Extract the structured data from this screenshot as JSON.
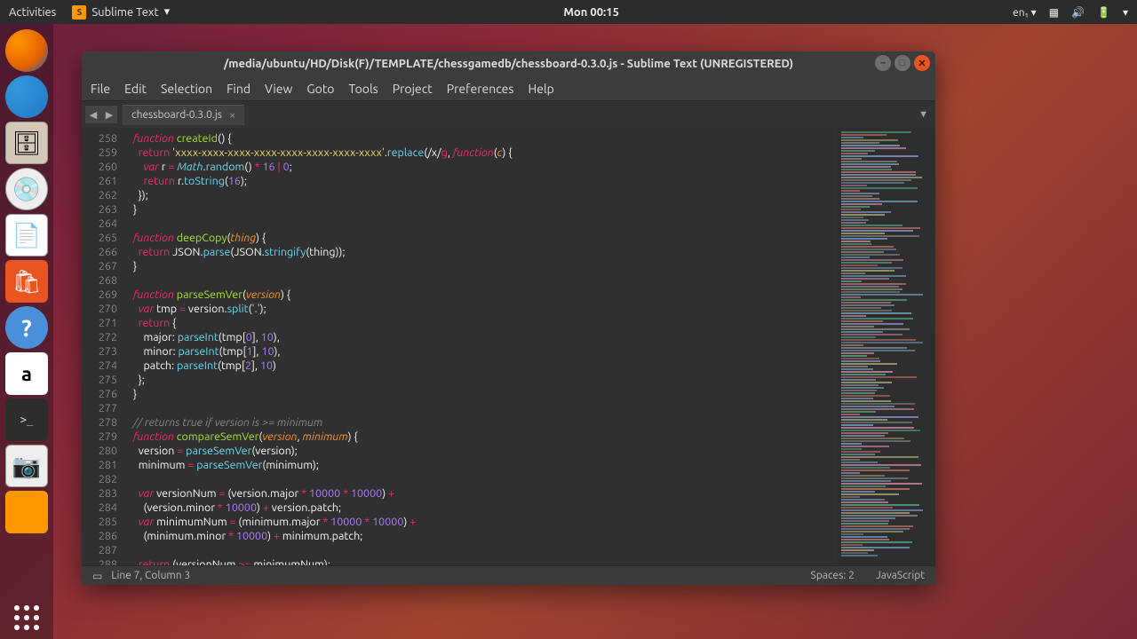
{
  "topbar": {
    "activities": "Activities",
    "app": "Sublime Text",
    "clock": "Mon 00:15",
    "lang": "en₁"
  },
  "window": {
    "title": "/media/ubuntu/HD/Disk(F)/TEMPLATE/chessgamedb/chessboard-0.3.0.js - Sublime Text (UNREGISTERED)",
    "menu": [
      "File",
      "Edit",
      "Selection",
      "Find",
      "View",
      "Goto",
      "Tools",
      "Project",
      "Preferences",
      "Help"
    ],
    "tab": "chessboard-0.3.0.js",
    "status": {
      "pos": "Line 7, Column 3",
      "spaces": "Spaces: 2",
      "lang": "JavaScript"
    }
  },
  "line_start": 258,
  "code": [
    [
      [
        "storage",
        "function"
      ],
      [
        "plain",
        " "
      ],
      [
        "func",
        "createId"
      ],
      [
        "plain",
        "() {"
      ]
    ],
    [
      [
        "plain",
        "  "
      ],
      [
        "keyword",
        "return"
      ],
      [
        "plain",
        " "
      ],
      [
        "str",
        "'xxxx-xxxx-xxxx-xxxx-xxxx-xxxx-xxxx-xxxx'"
      ],
      [
        "plain",
        "."
      ],
      [
        "call",
        "replace"
      ],
      [
        "plain",
        "(/x/"
      ],
      [
        "keyword",
        "g"
      ],
      [
        "plain",
        ", "
      ],
      [
        "storage",
        "function"
      ],
      [
        "plain",
        "("
      ],
      [
        "param",
        "c"
      ],
      [
        "plain",
        ") {"
      ]
    ],
    [
      [
        "plain",
        "    "
      ],
      [
        "storage",
        "var"
      ],
      [
        "plain",
        " r "
      ],
      [
        "op",
        "="
      ],
      [
        "plain",
        " "
      ],
      [
        "builtin",
        "Math"
      ],
      [
        "plain",
        "."
      ],
      [
        "call",
        "random"
      ],
      [
        "plain",
        "() "
      ],
      [
        "op",
        "*"
      ],
      [
        "plain",
        " "
      ],
      [
        "num",
        "16"
      ],
      [
        "plain",
        " "
      ],
      [
        "op",
        "|"
      ],
      [
        "plain",
        " "
      ],
      [
        "num",
        "0"
      ],
      [
        "plain",
        ";"
      ]
    ],
    [
      [
        "plain",
        "    "
      ],
      [
        "keyword",
        "return"
      ],
      [
        "plain",
        " r."
      ],
      [
        "call",
        "toString"
      ],
      [
        "plain",
        "("
      ],
      [
        "num",
        "16"
      ],
      [
        "plain",
        ");"
      ]
    ],
    [
      [
        "plain",
        "  });"
      ]
    ],
    [
      [
        "plain",
        "}"
      ]
    ],
    [
      [
        "plain",
        ""
      ]
    ],
    [
      [
        "storage",
        "function"
      ],
      [
        "plain",
        " "
      ],
      [
        "func",
        "deepCopy"
      ],
      [
        "plain",
        "("
      ],
      [
        "param",
        "thing"
      ],
      [
        "plain",
        ") {"
      ]
    ],
    [
      [
        "plain",
        "  "
      ],
      [
        "keyword",
        "return"
      ],
      [
        "plain",
        " JSON."
      ],
      [
        "call",
        "parse"
      ],
      [
        "plain",
        "(JSON."
      ],
      [
        "call",
        "stringify"
      ],
      [
        "plain",
        "(thing));"
      ]
    ],
    [
      [
        "plain",
        "}"
      ]
    ],
    [
      [
        "plain",
        ""
      ]
    ],
    [
      [
        "storage",
        "function"
      ],
      [
        "plain",
        " "
      ],
      [
        "func",
        "parseSemVer"
      ],
      [
        "plain",
        "("
      ],
      [
        "param",
        "version"
      ],
      [
        "plain",
        ") {"
      ]
    ],
    [
      [
        "plain",
        "  "
      ],
      [
        "storage",
        "var"
      ],
      [
        "plain",
        " tmp "
      ],
      [
        "op",
        "="
      ],
      [
        "plain",
        " version."
      ],
      [
        "call",
        "split"
      ],
      [
        "plain",
        "("
      ],
      [
        "str",
        "'.'"
      ],
      [
        "plain",
        ");"
      ]
    ],
    [
      [
        "plain",
        "  "
      ],
      [
        "keyword",
        "return"
      ],
      [
        "plain",
        " {"
      ]
    ],
    [
      [
        "plain",
        "    major: "
      ],
      [
        "call",
        "parseInt"
      ],
      [
        "plain",
        "(tmp["
      ],
      [
        "num",
        "0"
      ],
      [
        "plain",
        "], "
      ],
      [
        "num",
        "10"
      ],
      [
        "plain",
        "),"
      ]
    ],
    [
      [
        "plain",
        "    minor: "
      ],
      [
        "call",
        "parseInt"
      ],
      [
        "plain",
        "(tmp["
      ],
      [
        "num",
        "1"
      ],
      [
        "plain",
        "], "
      ],
      [
        "num",
        "10"
      ],
      [
        "plain",
        "),"
      ]
    ],
    [
      [
        "plain",
        "    patch: "
      ],
      [
        "call",
        "parseInt"
      ],
      [
        "plain",
        "(tmp["
      ],
      [
        "num",
        "2"
      ],
      [
        "plain",
        "], "
      ],
      [
        "num",
        "10"
      ],
      [
        "plain",
        ")"
      ]
    ],
    [
      [
        "plain",
        "  };"
      ]
    ],
    [
      [
        "plain",
        "}"
      ]
    ],
    [
      [
        "plain",
        ""
      ]
    ],
    [
      [
        "comment",
        "// returns true if version is >= minimum"
      ]
    ],
    [
      [
        "storage",
        "function"
      ],
      [
        "plain",
        " "
      ],
      [
        "func",
        "compareSemVer"
      ],
      [
        "plain",
        "("
      ],
      [
        "param",
        "version"
      ],
      [
        "plain",
        ", "
      ],
      [
        "param",
        "minimum"
      ],
      [
        "plain",
        ") {"
      ]
    ],
    [
      [
        "plain",
        "  version "
      ],
      [
        "op",
        "="
      ],
      [
        "plain",
        " "
      ],
      [
        "call",
        "parseSemVer"
      ],
      [
        "plain",
        "(version);"
      ]
    ],
    [
      [
        "plain",
        "  minimum "
      ],
      [
        "op",
        "="
      ],
      [
        "plain",
        " "
      ],
      [
        "call",
        "parseSemVer"
      ],
      [
        "plain",
        "(minimum);"
      ]
    ],
    [
      [
        "plain",
        ""
      ]
    ],
    [
      [
        "plain",
        "  "
      ],
      [
        "storage",
        "var"
      ],
      [
        "plain",
        " versionNum "
      ],
      [
        "op",
        "="
      ],
      [
        "plain",
        " (version.major "
      ],
      [
        "op",
        "*"
      ],
      [
        "plain",
        " "
      ],
      [
        "num",
        "10000"
      ],
      [
        "plain",
        " "
      ],
      [
        "op",
        "*"
      ],
      [
        "plain",
        " "
      ],
      [
        "num",
        "10000"
      ],
      [
        "plain",
        ") "
      ],
      [
        "op",
        "+"
      ]
    ],
    [
      [
        "plain",
        "    (version.minor "
      ],
      [
        "op",
        "*"
      ],
      [
        "plain",
        " "
      ],
      [
        "num",
        "10000"
      ],
      [
        "plain",
        ") "
      ],
      [
        "op",
        "+"
      ],
      [
        "plain",
        " version.patch;"
      ]
    ],
    [
      [
        "plain",
        "  "
      ],
      [
        "storage",
        "var"
      ],
      [
        "plain",
        " minimumNum "
      ],
      [
        "op",
        "="
      ],
      [
        "plain",
        " (minimum.major "
      ],
      [
        "op",
        "*"
      ],
      [
        "plain",
        " "
      ],
      [
        "num",
        "10000"
      ],
      [
        "plain",
        " "
      ],
      [
        "op",
        "*"
      ],
      [
        "plain",
        " "
      ],
      [
        "num",
        "10000"
      ],
      [
        "plain",
        ") "
      ],
      [
        "op",
        "+"
      ]
    ],
    [
      [
        "plain",
        "    (minimum.minor "
      ],
      [
        "op",
        "*"
      ],
      [
        "plain",
        " "
      ],
      [
        "num",
        "10000"
      ],
      [
        "plain",
        ") "
      ],
      [
        "op",
        "+"
      ],
      [
        "plain",
        " minimum.patch;"
      ]
    ],
    [
      [
        "plain",
        ""
      ]
    ],
    [
      [
        "plain",
        "  "
      ],
      [
        "keyword",
        "return"
      ],
      [
        "plain",
        " (versionNum "
      ],
      [
        "op",
        ">="
      ],
      [
        "plain",
        " minimumNum);"
      ]
    ]
  ]
}
